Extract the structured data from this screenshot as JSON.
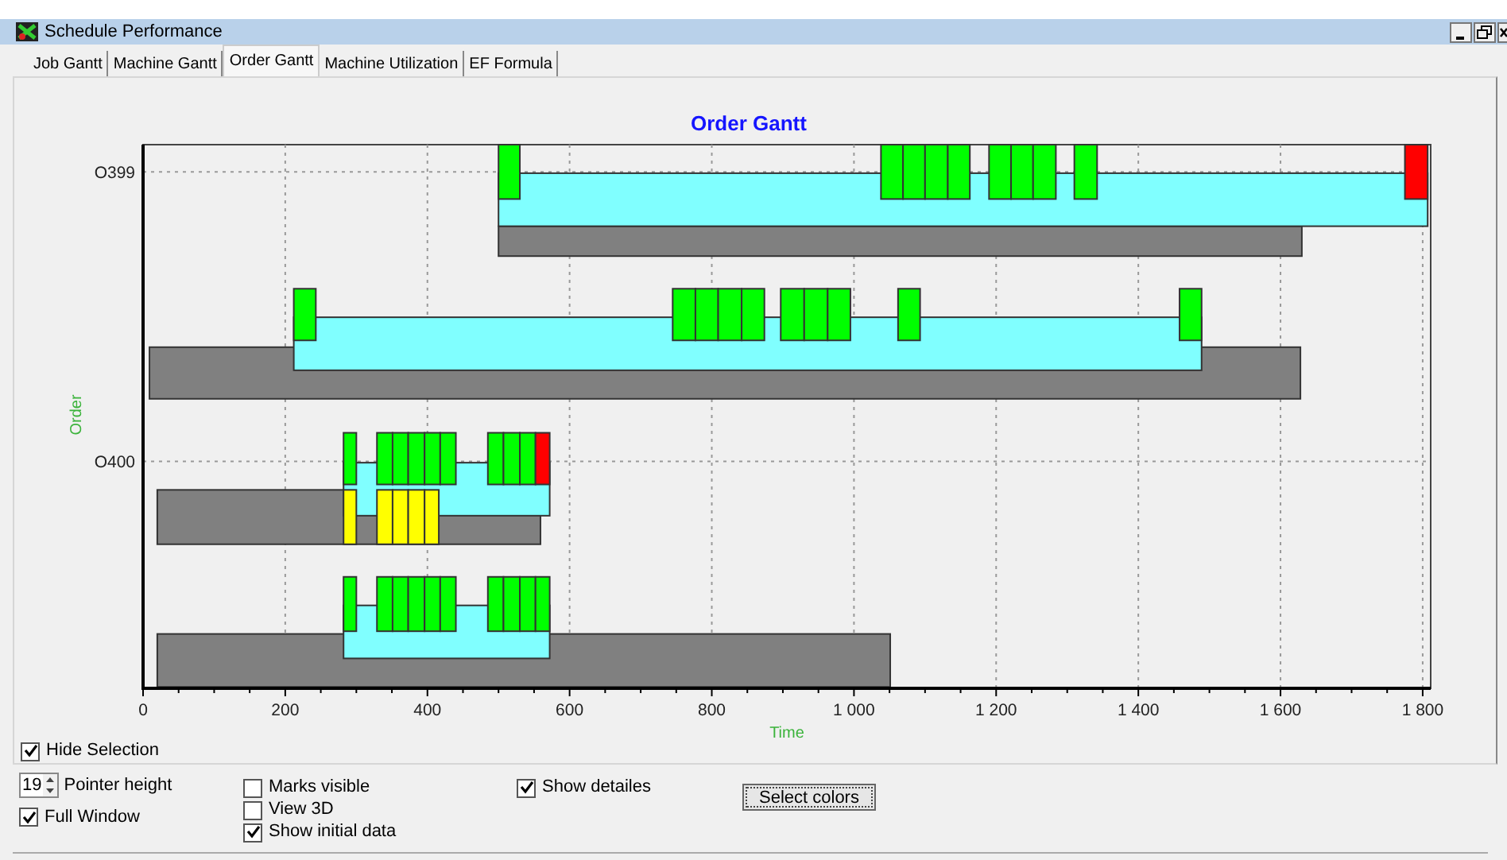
{
  "window": {
    "title": "Schedule Performance"
  },
  "tabs": [
    {
      "label": "Job Gantt",
      "selected": false
    },
    {
      "label": "Machine Gantt",
      "selected": false
    },
    {
      "label": "Order Gantt",
      "selected": true
    },
    {
      "label": "Machine Utilization",
      "selected": false
    },
    {
      "label": "EF Formula",
      "selected": false
    }
  ],
  "gantt": {
    "title": "Order Gantt",
    "xlabel": "Time",
    "ylabel": "Order",
    "x_tick_labels": [
      "0",
      "200",
      "400",
      "600",
      "800",
      "1 000",
      "1 200",
      "1 400",
      "1 600",
      "1 800"
    ],
    "row_labels": [
      "O399",
      "O400"
    ]
  },
  "hide_selection": {
    "label": "Hide Selection",
    "checked": true
  },
  "pointer_height": {
    "value": "19",
    "label": "Pointer height"
  },
  "options": [
    {
      "label": "Full Window",
      "checked": true
    },
    {
      "label": "Marks visible",
      "checked": false
    },
    {
      "label": "View 3D",
      "checked": false
    },
    {
      "label": "Show initial data",
      "checked": true
    },
    {
      "label": "Show detailes",
      "checked": true
    }
  ],
  "select_colors_button": "Select colors"
}
